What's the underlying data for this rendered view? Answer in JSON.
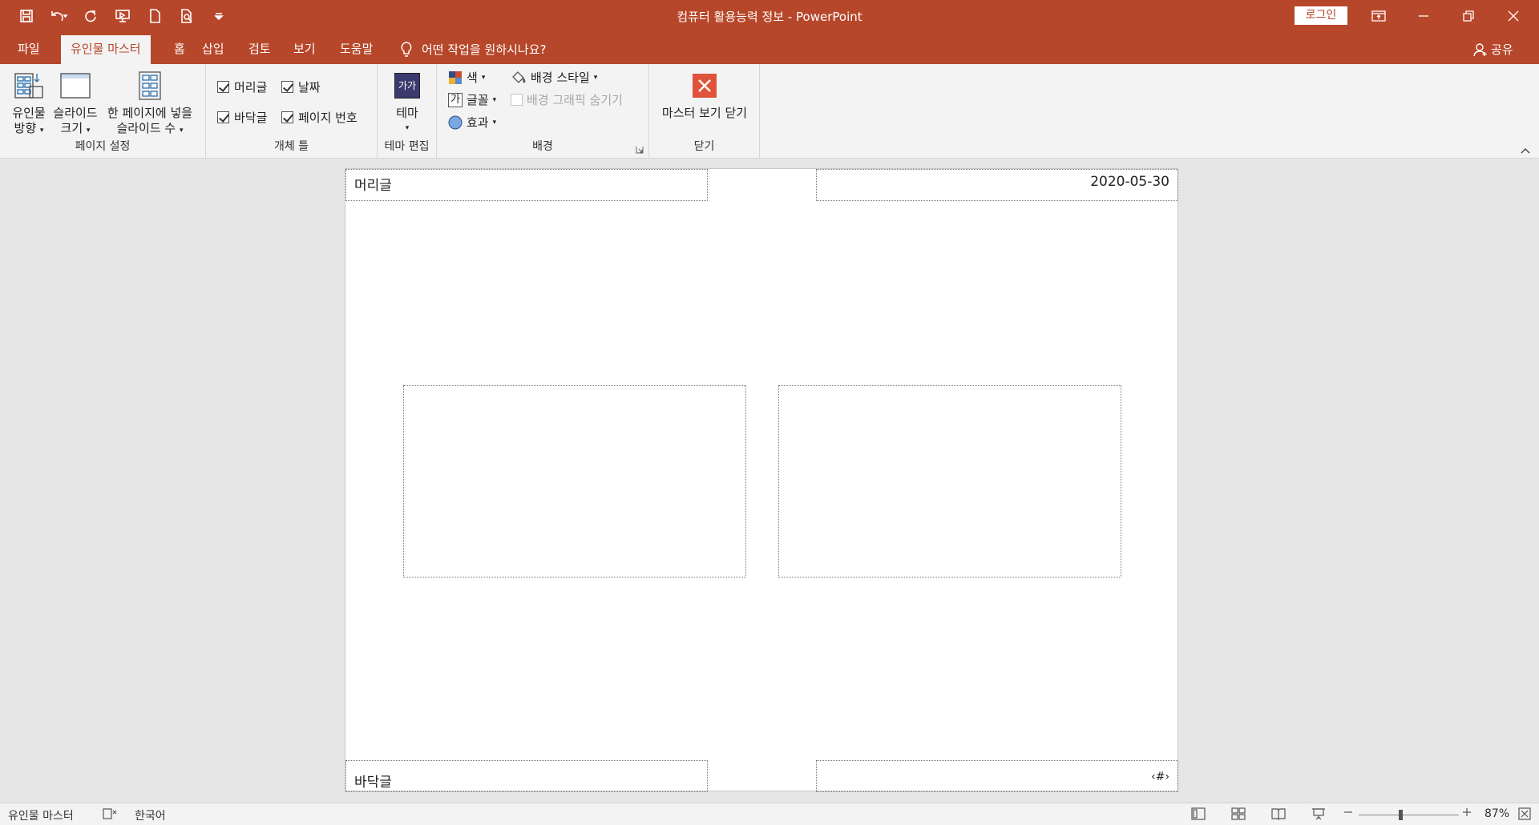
{
  "window": {
    "title": "컴퓨터 활용능력 정보  -  PowerPoint",
    "login_label": "로그인"
  },
  "quick_access": [
    "save-icon",
    "undo-icon",
    "redo-icon",
    "present-icon",
    "new-icon",
    "print-preview-icon",
    "customize-icon"
  ],
  "tabs": [
    {
      "label": "파일"
    },
    {
      "label": "유인물 마스터",
      "active": true
    },
    {
      "label": "홈"
    },
    {
      "label": "삽입"
    },
    {
      "label": "검토"
    },
    {
      "label": "보기"
    },
    {
      "label": "도움말"
    }
  ],
  "tell_me": "어떤 작업을 원하시나요?",
  "share_label": "공유",
  "ribbon": {
    "page_setup": {
      "label": "페이지 설정",
      "handout_orientation": {
        "line1": "유인물",
        "line2": "방향"
      },
      "slide_size": {
        "line1": "슬라이드",
        "line2": "크기"
      },
      "slides_per_page": {
        "line1": "한 페이지에 넣을",
        "line2": "슬라이드 수"
      }
    },
    "placeholders": {
      "label": "개체 틀",
      "header": {
        "label": "머리글",
        "checked": true
      },
      "date": {
        "label": "날짜",
        "checked": true
      },
      "footer": {
        "label": "바닥글",
        "checked": true
      },
      "page_number": {
        "label": "페이지 번호",
        "checked": true
      }
    },
    "edit_theme": {
      "label": "테마 편집",
      "theme_button": "테마",
      "theme_icon_text": "가가"
    },
    "background": {
      "label": "배경",
      "colors": "색",
      "fonts": "글꼴",
      "fonts_icon_text": "가",
      "effects": "효과",
      "background_styles": "배경 스타일",
      "hide_background_graphics": "배경 그래픽 숨기기"
    },
    "close": {
      "label": "닫기",
      "close_master_view": "마스터 보기 닫기"
    }
  },
  "slide": {
    "header_text": "머리글",
    "date_text": "2020-05-30",
    "footer_text": "바닥글",
    "page_number_text": "‹#›"
  },
  "status": {
    "view_name": "유인물 마스터",
    "language": "한국어",
    "zoom": "87%"
  },
  "colors": {
    "accent": "#b7472a",
    "ribbon_bg": "#f3f3f3",
    "workspace_bg": "#e6e6e6",
    "close_red": "#e0533b"
  }
}
